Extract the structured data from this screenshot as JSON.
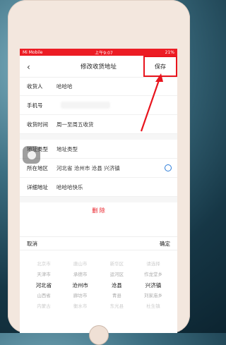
{
  "status": {
    "carrier": "Mi Mobile",
    "time": "上午9:07",
    "battery": "21%"
  },
  "header": {
    "title": "修改收货地址",
    "save_label": "保存"
  },
  "form": {
    "receiver_label": "收货人",
    "receiver_value": "哈哈哈",
    "phone_label": "手机号",
    "delivery_time_label": "收货时间",
    "delivery_time_value": "周一至周五收货",
    "address_type_label": "地址类型",
    "address_type_value": "地址类型",
    "region_label": "所在地区",
    "region_value": "河北省 沧州市 沧县 兴济镇",
    "detail_label": "详细地址",
    "detail_value": "哈哈哈快乐"
  },
  "delete_label": "删 除",
  "picker": {
    "cancel_label": "取消",
    "confirm_label": "确定",
    "columns": [
      [
        "北京市",
        "天津市",
        "河北省",
        "山西省",
        "内蒙古"
      ],
      [
        "唐山市",
        "承德市",
        "沧州市",
        "廊坊市",
        "衡水市"
      ],
      [
        "新华区",
        "运河区",
        "沧县",
        "青县",
        "东光县"
      ],
      [
        "请选择",
        "作龙堂乡",
        "兴济镇",
        "刘家庙乡",
        "杜生镇"
      ]
    ]
  }
}
